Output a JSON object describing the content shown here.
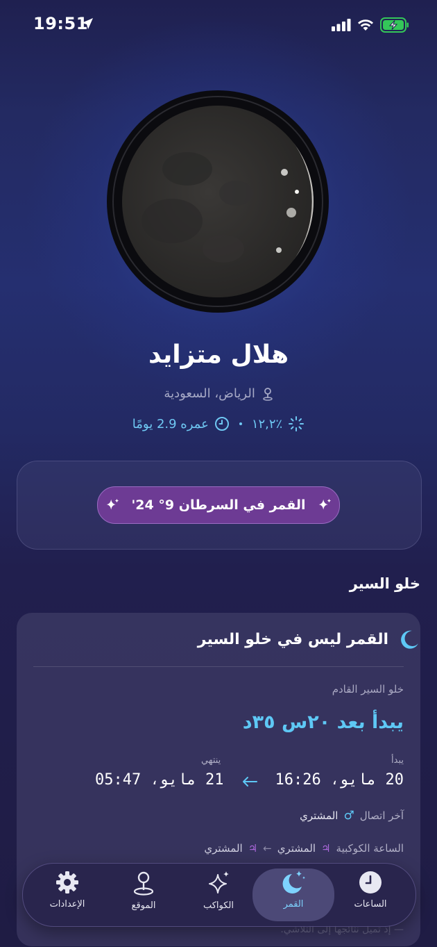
{
  "status_bar": {
    "time": "19:51"
  },
  "moon": {
    "phase_name": "هلال متزايد",
    "location": "الرياض، السعودية",
    "illumination": "٪١٢,٢",
    "age": "عمره 2.9 يومًا"
  },
  "zodiac": {
    "label": "القمر في السرطان 9° 24'"
  },
  "void_section": {
    "title": "خلو السير",
    "status": "القمر ليس في خلو السير",
    "next_label": "خلو السير القادم",
    "starts_in": "يبدأ بعد ٢٠س ٣٥د",
    "begins_label": "يبدأ",
    "ends_label": "ينتهي",
    "begins_value": "20 مايو، 16:26",
    "ends_value": "21 مايو، 05:47",
    "last_contact_label": "آخر اتصال",
    "last_contact_glyph": "♂",
    "last_contact_planet": "المشتري",
    "planetary_hour_label": "الساعة الكوكبية",
    "hour_glyph": "♃",
    "hour_from": "المشتري",
    "hour_to": "المشتري",
    "note": "— إذ تميل نتائجها إلى التلاشي."
  },
  "tabs": [
    {
      "label": "الساعات",
      "icon": "clock-icon"
    },
    {
      "label": "القمر",
      "icon": "moon-stars-icon",
      "active": true
    },
    {
      "label": "الكواكب",
      "icon": "sparkles-icon"
    },
    {
      "label": "الموقع",
      "icon": "location-pin-icon"
    },
    {
      "label": "الإعدادات",
      "icon": "gear-icon"
    }
  ],
  "colors": {
    "accent_cyan": "#5ec8f5",
    "zodiac_pill": "#6d3b94",
    "battery_green": "#34c759"
  }
}
